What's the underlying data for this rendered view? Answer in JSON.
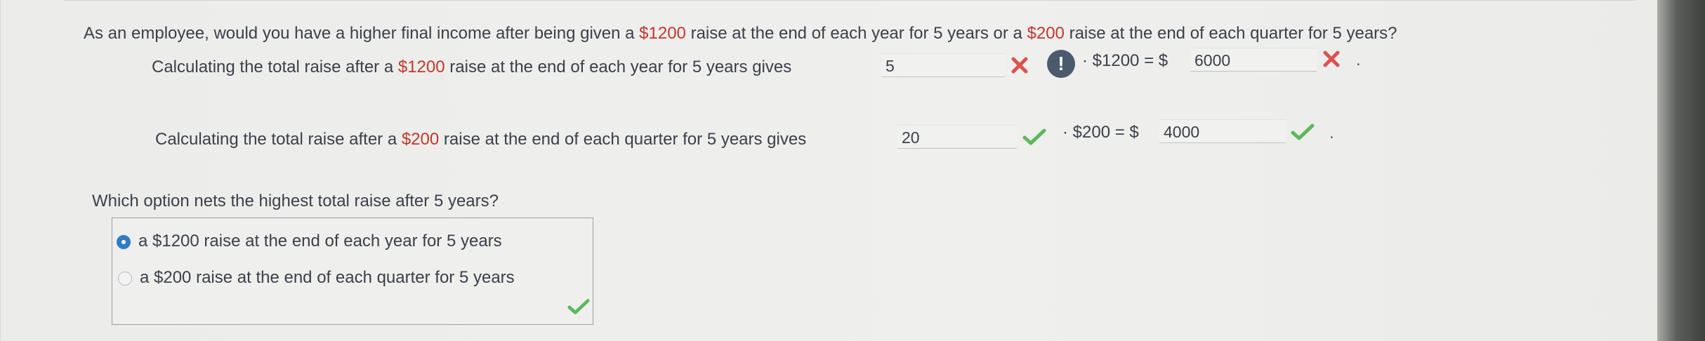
{
  "question": {
    "prefix": "As an employee, would you have a higher final income after being given a ",
    "amount_a": "$1200",
    "middle": " raise at the end of each year for 5 years or a ",
    "amount_b": "$200",
    "suffix": " raise at the end of each quarter for 5 years?"
  },
  "row1": {
    "prefix": "Calculating the total raise after a ",
    "amount": "$1200",
    "suffix": " raise at the end of each year for 5 years gives",
    "input1_value": "5",
    "input1_status": "incorrect",
    "alert_symbol": "!",
    "expression": "· $1200 = $",
    "input2_value": "6000",
    "input2_status": "incorrect",
    "end": "."
  },
  "row2": {
    "prefix": "Calculating the total raise after a ",
    "amount": "$200",
    "suffix": " raise at the end of each quarter for 5 years gives",
    "input1_value": "20",
    "input1_status": "correct",
    "expression": "· $200 = $",
    "input2_value": "4000",
    "input2_status": "correct",
    "end": "."
  },
  "which": {
    "label": "Which option nets the highest total raise after 5 years?",
    "options": [
      {
        "label": "a $1200 raise at the end of each year for 5 years",
        "selected": true
      },
      {
        "label": "a $200 raise at the end of each quarter for 5 years",
        "selected": false
      }
    ],
    "status": "correct"
  },
  "colors": {
    "highlight": "#c0392b",
    "correct": "#5cb85c",
    "incorrect": "#d9534f",
    "radio_selected": "#2f7cc6"
  }
}
